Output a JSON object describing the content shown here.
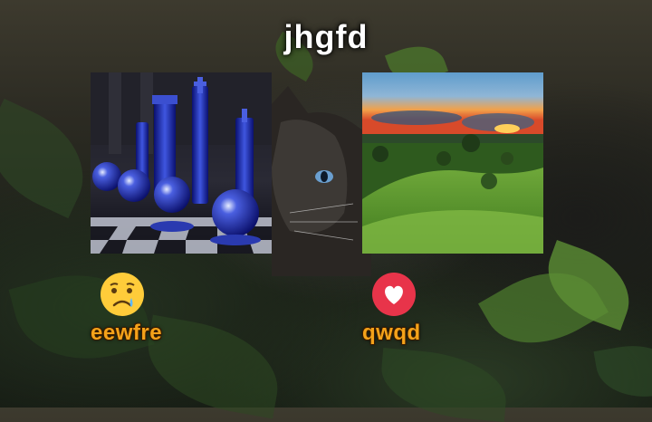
{
  "title": "jhgfd",
  "cards": [
    {
      "image": "chess-pieces-photo",
      "reaction_icon": "sad-face-icon",
      "caption": "eewfre"
    },
    {
      "image": "green-hills-sunset-photo",
      "reaction_icon": "heart-icon",
      "caption": "qwqd"
    }
  ],
  "colors": {
    "caption": "#f4a21a",
    "heart_badge": "#e8344a",
    "title": "#ffffff"
  }
}
